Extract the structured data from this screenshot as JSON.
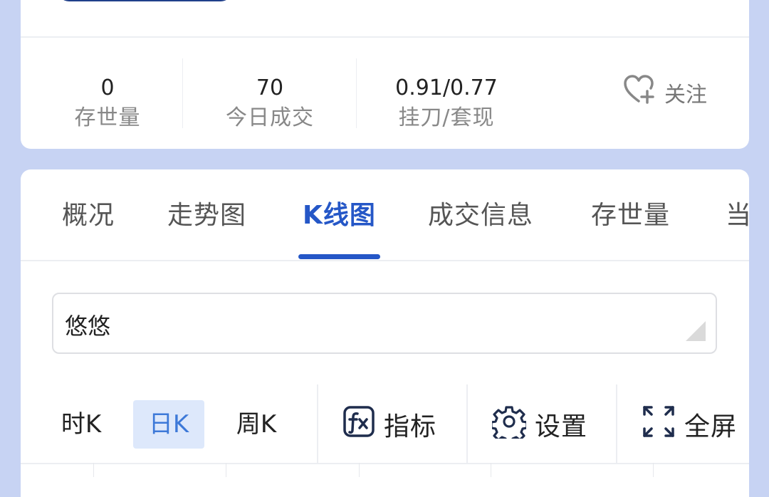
{
  "stats": [
    {
      "value": "0",
      "label": "存世量"
    },
    {
      "value": "70",
      "label": "今日成交"
    },
    {
      "value": "0.91/0.77",
      "label": "挂刀/套现"
    }
  ],
  "follow": {
    "label": "关注",
    "icon": "heart-plus-icon"
  },
  "tabs": {
    "items": [
      "概况",
      "走势图",
      "K线图",
      "成交信息",
      "存世量",
      "当"
    ],
    "active": "K线图"
  },
  "select": {
    "value": "悠悠"
  },
  "kline_periods": [
    {
      "label": "时K",
      "active": false
    },
    {
      "label": "日K",
      "active": true
    },
    {
      "label": "周K",
      "active": false
    }
  ],
  "tools": {
    "indicator": {
      "label": "指标",
      "icon": "fx-icon"
    },
    "settings": {
      "label": "设置",
      "icon": "gear-icon"
    },
    "fullscreen": {
      "label": "全屏",
      "icon": "fullscreen-icon"
    }
  },
  "colors": {
    "accent": "#2557c7",
    "background": "#c7d3f3",
    "active_period_bg": "#dde8fb"
  }
}
